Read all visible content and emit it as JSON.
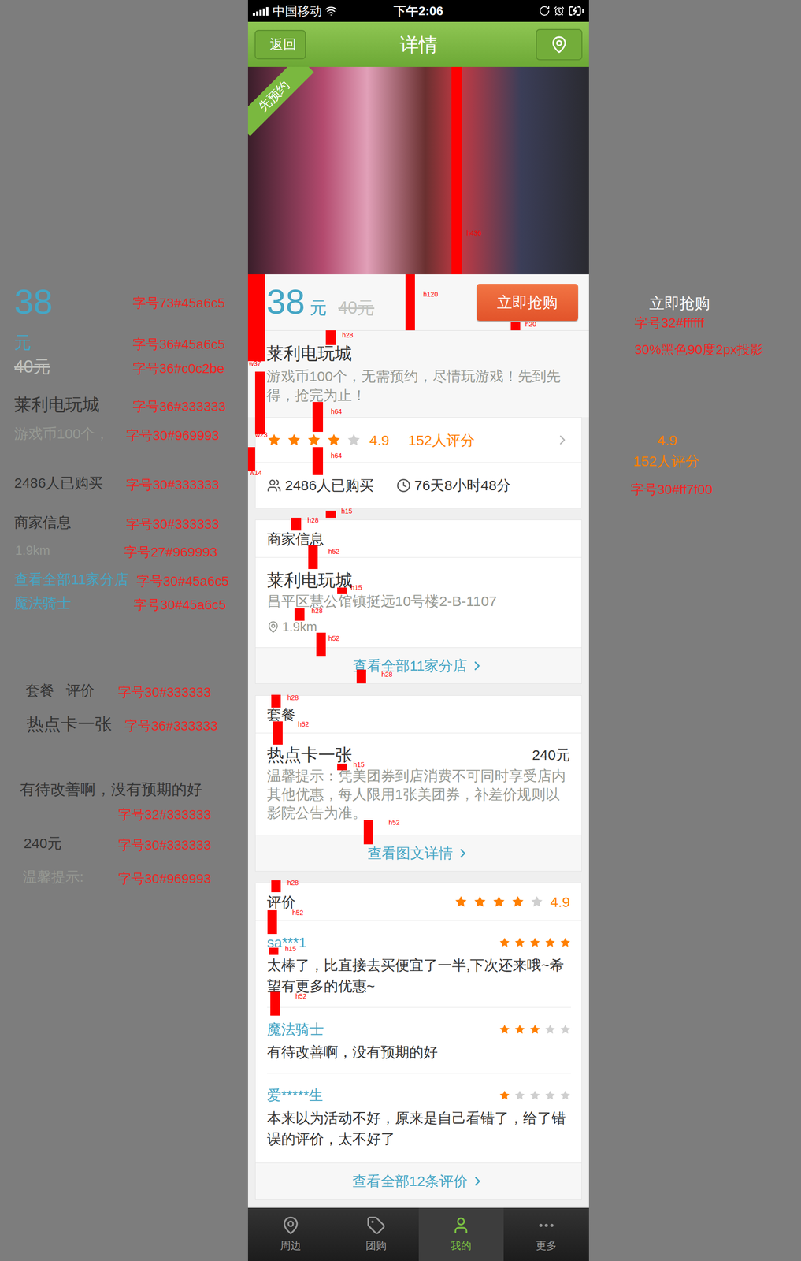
{
  "status_bar": {
    "carrier": "中国移动",
    "time": "下午2:06"
  },
  "nav": {
    "back": "返回",
    "title": "详情"
  },
  "hero": {
    "badge": "先预约"
  },
  "deal": {
    "price": "38",
    "unit": "元",
    "original_price": "40元",
    "buy_button": "立即抢购",
    "title": "莱利电玩城",
    "description": "游戏币100个，无需预约，尽情玩游戏！先到先得，抢完为止！"
  },
  "rating": {
    "stars": 4,
    "score": "4.9",
    "count": "152人评分",
    "sold": "2486人已购买",
    "remaining": "76天8小时48分"
  },
  "merchant": {
    "header": "商家信息",
    "name": "莱利电玩城",
    "address": "昌平区慧公馆镇挺远10号楼2-B-1107",
    "distance": "1.9km",
    "link": "查看全部11家分店"
  },
  "package": {
    "header": "套餐",
    "name": "热点卡一张",
    "price": "240元",
    "tips": "温馨提示：凭美团券到店消费不可同时享受店内其他优惠，每人限用1张美团券，补差价规则以影院公告为准。",
    "link": "查看图文详情"
  },
  "reviews": {
    "header": "评价",
    "stars": 4,
    "score": "4.9",
    "items": [
      {
        "user": "sa***1",
        "stars": 5,
        "text": "太棒了，比直接去买便宜了一半,下次还来哦~希望有更多的优惠~"
      },
      {
        "user": "魔法骑士",
        "stars": 3,
        "text": "有待改善啊，没有预期的好"
      },
      {
        "user": "爱*****生",
        "stars": 1,
        "text": "本来以为活动不好，原来是自己看错了，给了错误的评价，太不好了"
      }
    ],
    "link": "查看全部12条评价"
  },
  "tab_bar": [
    {
      "label": "周边",
      "selected": false
    },
    {
      "label": "团购",
      "selected": false
    },
    {
      "label": "我的",
      "selected": true
    },
    {
      "label": "更多",
      "selected": false
    }
  ],
  "annotations": {
    "left": [
      {
        "sample": "38",
        "spec": "字号73#45a6c5",
        "strikethrough": false,
        "kind": "inline"
      },
      {
        "sample": "元",
        "spec": "字号36#45a6c5",
        "strikethrough": false,
        "kind": "inline"
      },
      {
        "sample": "40元",
        "spec": "字号36#c0c2be",
        "strikethrough": true,
        "kind": "inline"
      },
      {
        "sample": "莱利电玩城",
        "spec": "字号36#333333",
        "strikethrough": false,
        "kind": "inline"
      },
      {
        "sample": "游戏币100个，",
        "spec": "字号30#969993",
        "strikethrough": false,
        "kind": "inline"
      },
      {
        "sample": "2486人已购买",
        "spec": "字号30#333333",
        "strikethrough": false,
        "kind": "inline"
      },
      {
        "sample": "商家信息",
        "spec": "字号30#333333",
        "strikethrough": false,
        "kind": "inline"
      },
      {
        "sample": "1.9km",
        "spec": "字号27#969993",
        "strikethrough": false,
        "kind": "inline"
      },
      {
        "sample": "查看全部11家分店",
        "spec": "字号30#45a6c5",
        "strikethrough": false,
        "kind": "inline"
      },
      {
        "sample": "魔法骑士",
        "spec": "字号30#45a6c5",
        "strikethrough": false,
        "kind": "inline"
      },
      {
        "sample": "套餐   评价",
        "spec": "字号30#333333",
        "strikethrough": false,
        "kind": "inline"
      },
      {
        "sample": "热点卡一张",
        "spec": "字号36#333333",
        "strikethrough": false,
        "kind": "inline"
      },
      {
        "sample": "有待改善啊，没有预期的好",
        "spec": "字号32#333333",
        "strikethrough": false,
        "kind": "stacked"
      },
      {
        "sample": "240元",
        "spec": "字号30#333333",
        "strikethrough": false,
        "kind": "inline"
      },
      {
        "sample": "温馨提示:",
        "spec": "字号30#969993",
        "strikethrough": false,
        "kind": "inline"
      }
    ],
    "right": [
      {
        "samples": [
          "立即抢购"
        ],
        "specs": [
          "字号32#ffffff",
          "30%黑色90度2px投影"
        ]
      },
      {
        "samples": [
          "4.9",
          "152人评分"
        ],
        "specs": [
          "字号30#ff7f00"
        ]
      }
    ]
  },
  "markers": [
    "h436",
    "h120",
    "h20",
    "h28",
    "w37",
    "w23",
    "w14",
    "h64",
    "h64",
    "h15",
    "h28",
    "h52",
    "h15",
    "h28",
    "h52",
    "h28",
    "h28",
    "h52",
    "h15",
    "h52",
    "h28",
    "h52",
    "h15",
    "h52"
  ]
}
